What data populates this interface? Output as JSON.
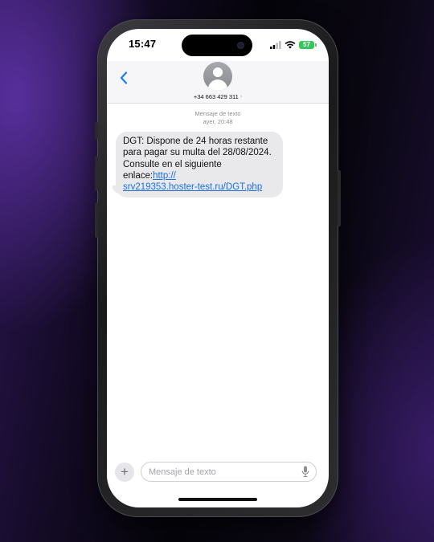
{
  "status_bar": {
    "time": "15:47",
    "battery_level": "57",
    "battery_color": "#34c759"
  },
  "header": {
    "back_icon": "chevron-left-icon",
    "avatar_icon": "person-silhouette-icon",
    "contact_number": "+34 663 429 311",
    "contact_chevron": "›"
  },
  "messages": {
    "service_label": "Mensaje de texto",
    "timestamp": "ayer, 20:48",
    "items": [
      {
        "text": "DGT: Dispone de 24 horas restante para pagar su multa del 28/08/2024. Consulte en el siguiente enlace:",
        "link": "http://srv219353.hoster-test.ru/DGT.php",
        "link_line_1": "http://",
        "link_line_2": "srv219353.hoster-test.ru/DGT.php"
      }
    ]
  },
  "compose": {
    "plus_label": "+",
    "placeholder": "Mensaje de texto",
    "mic_icon": "microphone-icon"
  },
  "colors": {
    "accent": "#1a6fe0",
    "incoming_bubble": "#e9e9eb",
    "background_purple": "#2a1450"
  }
}
